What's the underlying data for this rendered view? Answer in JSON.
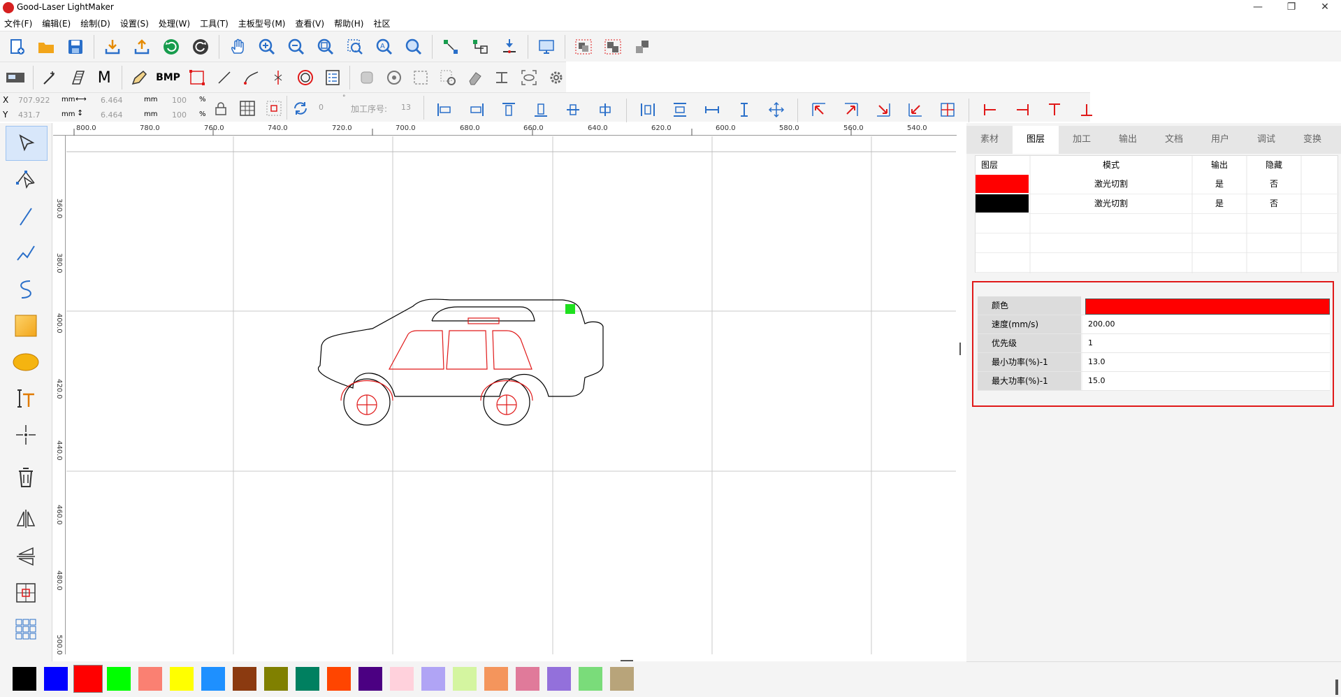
{
  "window": {
    "title": "Good-Laser LightMaker",
    "controls": [
      "—",
      "❐",
      "✕"
    ]
  },
  "menu": [
    "文件(F)",
    "编辑(E)",
    "绘制(D)",
    "设置(S)",
    "处理(W)",
    "工具(T)",
    "主板型号(M)",
    "查看(V)",
    "帮助(H)",
    "社区"
  ],
  "toolbar2": {
    "bmp_label": "BMP",
    "m_label": "M"
  },
  "coords": {
    "x_label": "X",
    "x_value": "707.922",
    "y_label": "Y",
    "y_value": "431.7",
    "w_value": "6.464",
    "h_value": "6.464",
    "unit": "mm",
    "w_pct": "100",
    "h_pct": "100",
    "pct": "%",
    "rotate_value": "0",
    "order_label": "加工序号:",
    "order_value": "13"
  },
  "ruler": {
    "h_labels": [
      "800.0",
      "780.0",
      "760.0",
      "740.0",
      "720.0",
      "700.0",
      "680.0",
      "660.0",
      "640.0",
      "620.0",
      "600.0",
      "580.0",
      "560.0",
      "540.0"
    ],
    "v_labels": [
      "360.0",
      "380.0",
      "400.0",
      "420.0",
      "440.0",
      "460.0",
      "480.0",
      "500.0"
    ]
  },
  "tabs": [
    "素材",
    "图层",
    "加工",
    "输出",
    "文档",
    "用户",
    "调试",
    "变换"
  ],
  "active_tab": "图层",
  "layers": {
    "headers": [
      "图层",
      "模式",
      "输出",
      "隐藏"
    ],
    "rows": [
      {
        "color": "#ff0000",
        "mode": "激光切割",
        "output": "是",
        "hidden": "否"
      },
      {
        "color": "#000000",
        "mode": "激光切割",
        "output": "是",
        "hidden": "否"
      }
    ]
  },
  "properties": {
    "color_label": "颜色",
    "color_value": "#ff0000",
    "speed_label": "速度(mm/s)",
    "speed_value": "200.00",
    "priority_label": "优先级",
    "priority_value": "1",
    "min_power_label": "最小功率(%)-1",
    "min_power_value": "13.0",
    "max_power_label": "最大功率(%)-1",
    "max_power_value": "15.0"
  },
  "palette": [
    "#000000",
    "#0000ff",
    "#ff0000",
    "#00ff00",
    "#fa8072",
    "#ffff00",
    "#1e90ff",
    "#8b3a10",
    "#808000",
    "#008060",
    "#ff4500",
    "#4b0082",
    "#ffd1dc",
    "#b0a4f5",
    "#d4f5a0",
    "#f4955c",
    "#e07a9a",
    "#9370db",
    "#7adc7a",
    "#b8a47a"
  ],
  "palette_selected": "#ff0000"
}
